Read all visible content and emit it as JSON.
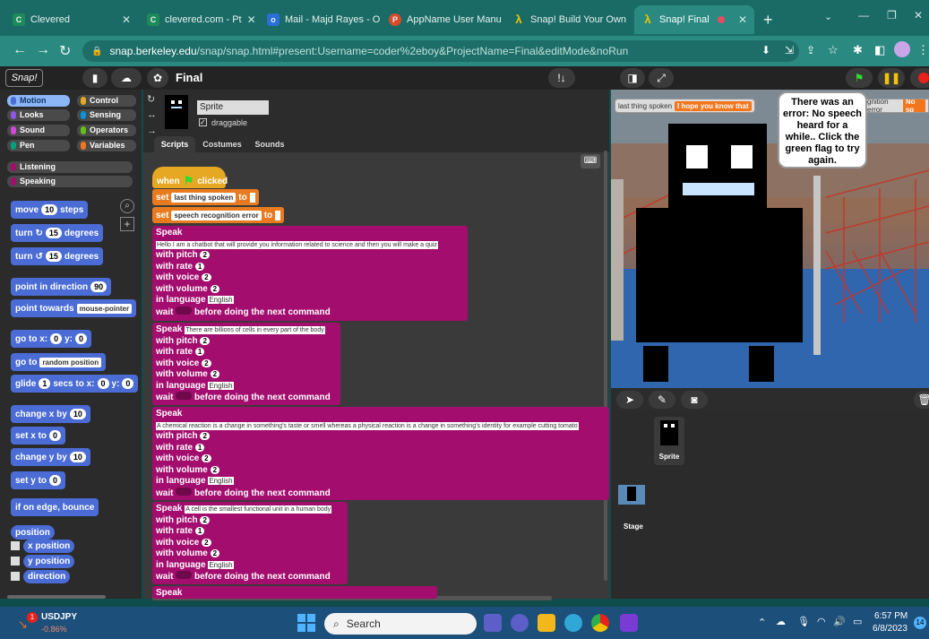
{
  "tabs": [
    {
      "label": "Clevered",
      "fav_color": "#1e8a5a",
      "fav": "C"
    },
    {
      "label": "clevered.com - Pt",
      "fav_color": "#1e8a5a",
      "fav": "C"
    },
    {
      "label": "Mail - Majd Rayes - O",
      "fav_color": "#2a6fd6",
      "fav": "o"
    },
    {
      "label": "AppName User Manu",
      "fav_color": "#d94a2a",
      "fav": "P"
    },
    {
      "label": "Snap! Build Your Own",
      "fav_color": "#f2c400",
      "fav": "λ"
    },
    {
      "label": "Snap! Final",
      "fav_color": "#f2c400",
      "fav": "λ"
    }
  ],
  "address": {
    "host": "snap.berkeley.edu",
    "path": "/snap/snap.html#present:Username=coder%2eboy&ProjectName=Final&editMode&noRun"
  },
  "snap": {
    "logo": "Snap!",
    "project_name": "Final",
    "categories": [
      {
        "label": "Motion",
        "color": "#4a6cd4",
        "selected": true
      },
      {
        "label": "Control",
        "color": "#e6a822"
      },
      {
        "label": "Looks",
        "color": "#8f56e3"
      },
      {
        "label": "Sensing",
        "color": "#0494dc"
      },
      {
        "label": "Sound",
        "color": "#cf4ad9"
      },
      {
        "label": "Operators",
        "color": "#62c213"
      },
      {
        "label": "Pen",
        "color": "#00a178"
      },
      {
        "label": "Variables",
        "color": "#f3761d"
      },
      {
        "label": "Listening",
        "color": "#a30d6e"
      },
      {
        "label": "Speaking",
        "color": "#a30d6e"
      }
    ],
    "palette_blocks": {
      "move": "move",
      "move_val": "10",
      "move_unit": "steps",
      "turn": "turn",
      "turn_val": "15",
      "turn_unit": "degrees",
      "point_dir": "point in direction",
      "point_dir_val": "90",
      "point_towards": "point towards",
      "point_towards_val": "mouse-pointer",
      "goto_xy": "go to x:",
      "goto_x": "0",
      "goto_y_label": "y:",
      "goto_y": "0",
      "goto": "go to",
      "goto_val": "random position",
      "glide": "glide",
      "glide_val": "1",
      "glide_mid": "secs to x:",
      "glide_x": "0",
      "glide_y_label": "y:",
      "glide_y": "0",
      "change_x": "change x by",
      "change_x_val": "10",
      "set_x": "set x to",
      "set_x_val": "0",
      "change_y": "change y by",
      "change_y_val": "10",
      "set_y": "set y to",
      "set_y_val": "0",
      "bounce": "if on edge, bounce",
      "position": "position",
      "x_position": "x position",
      "y_position": "y position",
      "direction": "direction"
    },
    "sprite": {
      "name": "Sprite",
      "draggable_label": "draggable",
      "tabs": [
        "Scripts",
        "Costumes",
        "Sounds"
      ]
    },
    "script": {
      "hat": "when",
      "hat_suffix": "clicked",
      "set1_label": "set",
      "set1_var": "last thing spoken",
      "set1_to": "to",
      "set2_label": "set",
      "set2_var": "speech recognition error",
      "set2_to": "to",
      "speak_label": "Speak",
      "with_pitch": "with pitch",
      "with_rate": "with rate",
      "with_voice": "with voice",
      "with_volume": "with volume",
      "in_language": "in language",
      "wait": "wait",
      "before": "before doing the next command",
      "pitch": "2",
      "rate": "1",
      "voice": "2",
      "volume": "2",
      "language": "English",
      "texts": [
        "Hello I am a chatbot that will provide you information related to science and then you will make a quiz",
        "There are billions of cells in every part of the body",
        "A chemical reaction is a change in something's taste or smell whereas a physical reaction is a change in something's identity for example cutting tomato",
        "A cell is the smallest functional unit in a human body",
        ""
      ]
    },
    "stage": {
      "watcher1_label": "last thing spoken",
      "watcher1_value": "I hope you know that",
      "watcher2_label": "gnition error",
      "watcher2_value": "No sp",
      "bubble": "There was an error: No speech heard for a while.. Click the green flag to try again."
    },
    "corral": {
      "sprite_label": "Sprite",
      "stage_label": "Stage"
    }
  },
  "taskbar": {
    "ticker": "USDJPY",
    "change": "-0.86%",
    "badge": "1",
    "search": "Search",
    "time": "6:57 PM",
    "date": "6/8/2023",
    "notif": "14"
  }
}
